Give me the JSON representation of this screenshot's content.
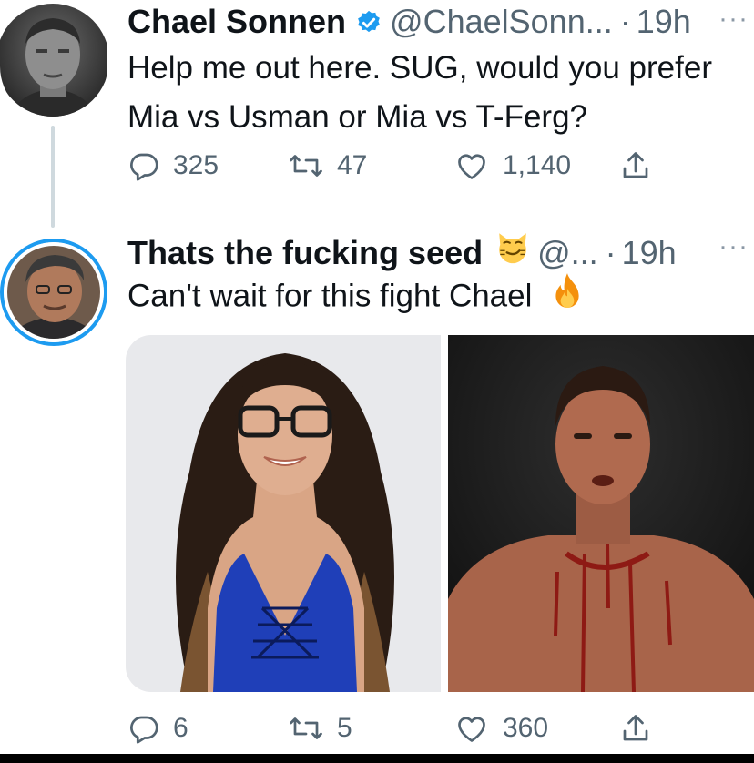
{
  "tweet1": {
    "name": "Chael Sonnen",
    "handle": "@ChaelSonn...",
    "time": "19h",
    "text_line1": "Help me out here. SUG, would you prefer",
    "text_line2": "Mia vs Usman or Mia vs T-Ferg?",
    "replies": "325",
    "retweets": "47",
    "likes": "1,140"
  },
  "tweet2": {
    "name": "Thats the fucking seed",
    "handle": "@...",
    "time": "19h",
    "text": "Can't wait for this fight Chael",
    "replies": "6",
    "retweets": "5",
    "likes": "360"
  },
  "separators": {
    "dot": "·",
    "more": "···"
  },
  "colors": {
    "text": "#0f1419",
    "secondary": "#536471",
    "verified": "#1d9bf0",
    "thread_line": "#cfd9de"
  },
  "icons": [
    "verified-badge-icon",
    "reply-icon",
    "retweet-icon",
    "like-icon",
    "share-icon",
    "smirking-cat-emoji",
    "fire-emoji",
    "more-icon"
  ]
}
